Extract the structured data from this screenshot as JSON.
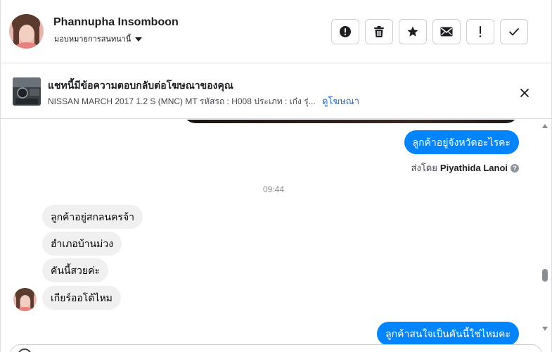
{
  "header": {
    "contact_name": "Phannupha Insomboon",
    "assign_label": "มอบหมายการสนทนานี้",
    "actions": [
      {
        "name": "spam",
        "icon": "exclamation-circle-icon"
      },
      {
        "name": "delete",
        "icon": "trash-icon"
      },
      {
        "name": "star",
        "icon": "star-icon"
      },
      {
        "name": "mark-unread",
        "icon": "envelope-icon"
      },
      {
        "name": "follow-up",
        "icon": "exclamation-icon"
      },
      {
        "name": "done",
        "icon": "check-icon"
      }
    ]
  },
  "ad_banner": {
    "title": "แชทนี้มีข้อความตอบกลับต่อโฆษณาของคุณ",
    "description": "NISSAN MARCH 2017 1.2 S (MNC) MT รหัสรถ : H008 ประเภท : เก๋ง รุ่...",
    "link_label": "ดูโฆษณา"
  },
  "messages": {
    "outgoing_1": "ลูกค้าอยู่จังหวัดอะไรคะ",
    "sent_by_prefix": "ส่งโดย",
    "sent_by_name": "Piyathida Lanoi",
    "help_glyph": "?",
    "timestamp": "09:44",
    "incoming_1": "ลูกค้าอยู่สกลนครจ้า",
    "incoming_2": "ฮำเภอบ้านม่วง",
    "incoming_3": "คันนี้สวยค่ะ",
    "incoming_4": "เกียร์ออโต้ไหม",
    "outgoing_2": "ลูกค้าสนใจเป็นคันนี้ใช่ไหมคะ"
  },
  "colors": {
    "accent": "#0084ff",
    "link": "#216fdb",
    "incoming_bubble": "#f0f0f0"
  }
}
